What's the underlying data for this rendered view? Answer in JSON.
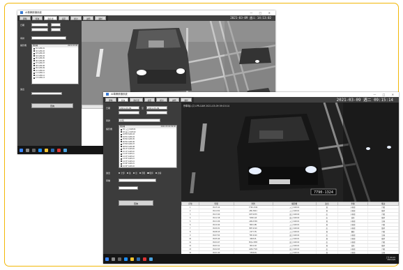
{
  "win1": {
    "title": "AI車牌辨識系統",
    "datetime": "2021-03-09 週二 14:13:02",
    "window_controls": "— □ ✕",
    "tabs": [
      "即時",
      "查詢",
      "黑名單",
      "設定",
      "統計",
      "說明",
      "關於"
    ],
    "panel_labels": [
      "日期",
      "車牌",
      "攝影機",
      "進出"
    ],
    "list_header_left": "攝影機",
    "list_header_right": "2021-03-09",
    "list_items": [
      "01 CAM-01",
      "02 CAM-02",
      "03 CAM-03",
      "04 CAM-04",
      "05 CAM-05",
      "06 CAM-06",
      "07 CAM-07",
      "08 CAM-08",
      "09 CAM-09",
      "10 CAM-10",
      "11 CAM-11",
      "12 CAM-12",
      "13 CAM-13"
    ],
    "search_button": "查詢"
  },
  "win2": {
    "title": "AI車牌辨識系統",
    "datetime": "2021-03-09 週二 09:15:14",
    "window_controls": "— □ ✕",
    "tabs": [
      "即時",
      "查詢",
      "黑名單",
      "設定",
      "統計",
      "說明",
      "關於"
    ],
    "video_caption": "停車場入口 LPR-CAM 2021-03-09 09:15:14",
    "plate_text": "7790-1324",
    "panel_labels": [
      "日期",
      "至",
      "車牌",
      "攝影機",
      "進出",
      "車種"
    ],
    "date_from": "2021-03-09",
    "date_to": "2021-03-09",
    "plate_field": "全部",
    "list_header_left": "攝影機",
    "list_header_right": "2021-03-09 09:00",
    "list_items": [
      "01 入口 CAM-01",
      "02 出口 CAM-02",
      "03 B1 CAM-03",
      "04 B1 CAM-04",
      "05 B2 CAM-05",
      "06 B2 CAM-06",
      "07 B3 CAM-07",
      "08 B3 CAM-08",
      "09 1F CAM-09",
      "10 1F CAM-10",
      "11 2F CAM-11",
      "12 2F CAM-12",
      "13 3F CAM-13",
      "14 3F CAM-14",
      "15 RF CAM-15",
      "16 RF CAM-16"
    ],
    "radio_options": [
      "全部",
      "進",
      "出",
      "月租",
      "臨停",
      "訪客"
    ],
    "search_button": "查詢",
    "table_columns": [
      "序號",
      "時間",
      "車牌",
      "攝影機",
      "進出",
      "車種",
      "備註"
    ],
    "table_rows": [
      [
        "1",
        "09:15:14",
        "7790-1324",
        "入口 CAM-01",
        "進",
        "小客車",
        "月租"
      ],
      [
        "2",
        "09:14:52",
        "ABC-5821",
        "入口 CAM-01",
        "進",
        "小客車",
        "臨停"
      ],
      [
        "3",
        "09:13:40",
        "RDF-2035",
        "出口 CAM-02",
        "出",
        "小客車",
        "月租"
      ],
      [
        "4",
        "09:12:18",
        "5682-QZ",
        "出口 CAM-02",
        "出",
        "貨車",
        "臨停"
      ],
      [
        "5",
        "09:11:06",
        "AKN-6709",
        "入口 CAM-01",
        "進",
        "小客車",
        "訪客"
      ],
      [
        "6",
        "09:10:44",
        "8821-MK",
        "入口 CAM-01",
        "進",
        "小客車",
        "月租"
      ],
      [
        "7",
        "09:09:31",
        "BRT-1190",
        "出口 CAM-02",
        "出",
        "小客車",
        "臨停"
      ],
      [
        "8",
        "09:08:15",
        "2277-HV",
        "入口 CAM-01",
        "進",
        "機車",
        "月租"
      ],
      [
        "9",
        "09:07:02",
        "TKE-4410",
        "出口 CAM-02",
        "出",
        "小客車",
        "訪客"
      ],
      [
        "10",
        "09:05:49",
        "6603-PL",
        "入口 CAM-01",
        "進",
        "小客車",
        "臨停"
      ],
      [
        "11",
        "09:04:27",
        "MQA-3385",
        "出口 CAM-02",
        "出",
        "小客車",
        "月租"
      ],
      [
        "12",
        "09:03:11",
        "9014-CD",
        "入口 CAM-01",
        "進",
        "貨車",
        "臨停"
      ],
      [
        "13",
        "09:02:05",
        "LWN-7726",
        "出口 CAM-02",
        "出",
        "小客車",
        "月租"
      ],
      [
        "14",
        "09:01:40",
        "3358-RS",
        "入口 CAM-01",
        "進",
        "小客車",
        "訪客"
      ],
      [
        "15",
        "09:00:12",
        "GHY-0932",
        "出口 CAM-02",
        "出",
        "小客車",
        "臨停"
      ]
    ],
    "clock_time": "上午 09:15",
    "clock_date": "2021/3/9"
  },
  "taskbar_icons": [
    "windows-icon",
    "search-icon",
    "task-view-icon",
    "edge-icon",
    "explorer-icon",
    "store-icon",
    "mail-icon",
    "app-icon"
  ],
  "colors": {
    "frame": "#f2b705",
    "window_bg": "#404040",
    "taskbar": "#151515"
  }
}
